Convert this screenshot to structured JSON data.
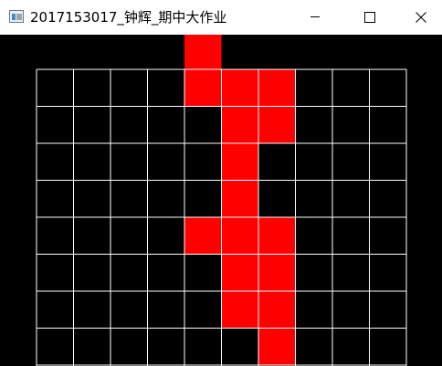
{
  "window": {
    "title": "2017153017_钟辉_期中大作业",
    "minimize_icon": "minimize-icon",
    "maximize_icon": "maximize-icon",
    "close_icon": "close-icon"
  },
  "game": {
    "columns": 10,
    "visible_rows": 8,
    "colors": {
      "background": "#000000",
      "grid": "#ffffff",
      "block": "#ff0000"
    },
    "falling_piece": [
      [
        -1,
        4
      ],
      [
        0,
        4
      ],
      [
        0,
        5
      ],
      [
        0,
        6
      ],
      [
        1,
        5
      ],
      [
        1,
        6
      ]
    ],
    "stack": [
      [
        2,
        5
      ],
      [
        3,
        5
      ],
      [
        4,
        4
      ],
      [
        4,
        5
      ],
      [
        4,
        6
      ],
      [
        5,
        5
      ],
      [
        5,
        6
      ],
      [
        6,
        5
      ],
      [
        6,
        6
      ],
      [
        7,
        6
      ]
    ]
  }
}
